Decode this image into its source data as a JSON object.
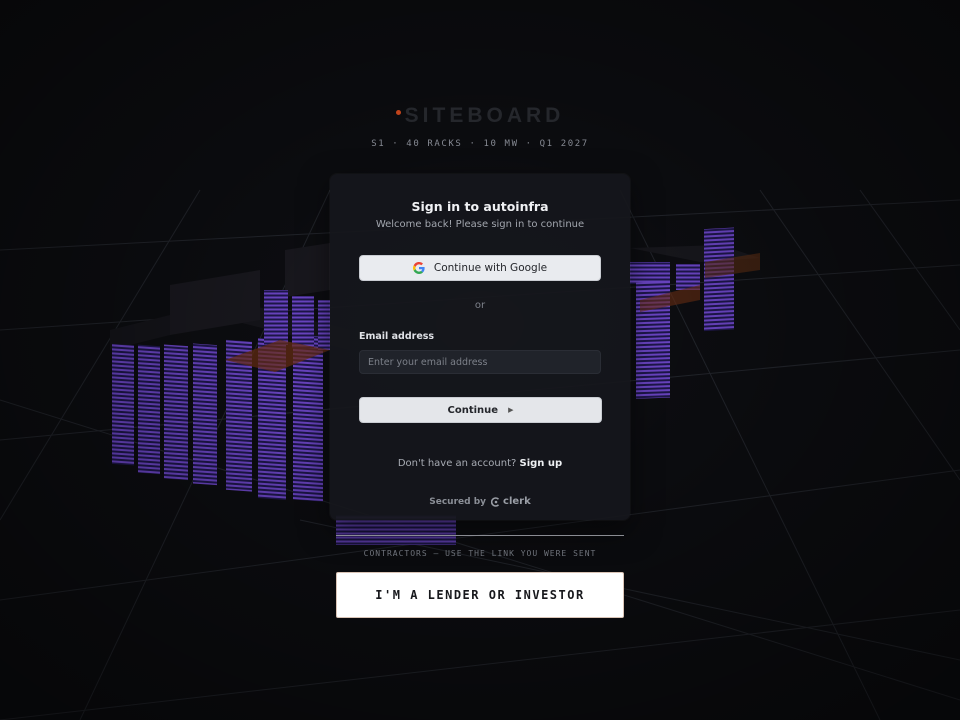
{
  "brand": {
    "title": "SITEBOARD",
    "subtitle": "S1 · 40 RACKS · 10 MW · Q1 2027",
    "accent_color": "#c2441b"
  },
  "auth_card": {
    "title": "Sign in to autoinfra",
    "subtitle": "Welcome back! Please sign in to continue",
    "google_button": "Continue with Google",
    "divider_text": "or",
    "email_label": "Email address",
    "email_placeholder": "Enter your email address",
    "email_value": "",
    "continue_button": "Continue",
    "no_account_text": "Don't have an account?",
    "signup_link": "Sign up",
    "secured_by": "Secured by",
    "provider": "clerk"
  },
  "footer": {
    "contractors_note": "CONTRACTORS — USE THE LINK YOU WERE SENT",
    "investor_button": "I'M A LENDER OR INVESTOR"
  },
  "icons": {
    "google": "google-logo-icon",
    "continue": "triangle-right-icon",
    "clerk": "clerk-logo-icon"
  },
  "colors": {
    "background": "#0e0f13",
    "card": "#16171c",
    "rack_glow": "#6a3bc8",
    "hot_spot": "#c2441b"
  }
}
